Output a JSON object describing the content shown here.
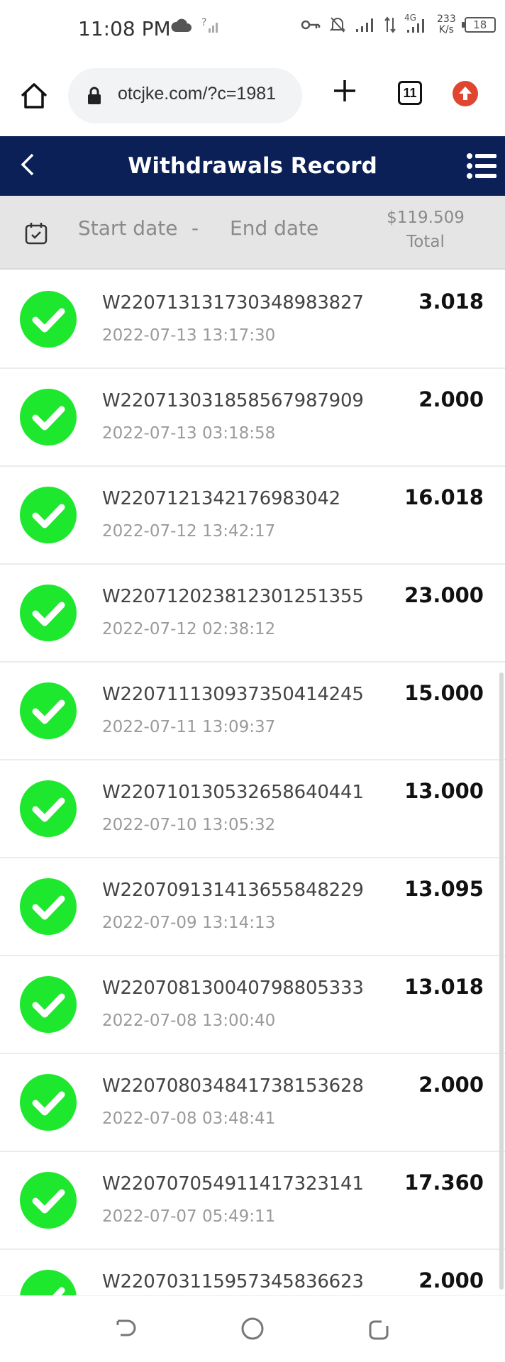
{
  "status_bar": {
    "time": "11:08 PM",
    "speed_value": "233",
    "speed_unit": "K/s",
    "network_label": "4G",
    "battery": "18",
    "icons": [
      "cloud-icon",
      "signal-unknown-icon",
      "vpn-key-icon",
      "bell-off-icon",
      "signal-icon",
      "data-arrows-icon",
      "signal-4g-icon",
      "battery-icon"
    ]
  },
  "browser": {
    "url": "otcjke.com/?c=1981",
    "tab_count": "11"
  },
  "header": {
    "title": "Withdrawals Record"
  },
  "filter": {
    "start_date": "Start date",
    "separator": "-",
    "end_date": "End date",
    "total_amount": "$119.509",
    "total_label": "Total"
  },
  "records": [
    {
      "id": "W220713131730348983827",
      "time": "2022-07-13 13:17:30",
      "amount": "3.018"
    },
    {
      "id": "W220713031858567987909",
      "time": "2022-07-13 03:18:58",
      "amount": "2.000"
    },
    {
      "id": "W2207121342176983042",
      "time": "2022-07-12 13:42:17",
      "amount": "16.018"
    },
    {
      "id": "W220712023812301251355",
      "time": "2022-07-12 02:38:12",
      "amount": "23.000"
    },
    {
      "id": "W220711130937350414245",
      "time": "2022-07-11 13:09:37",
      "amount": "15.000"
    },
    {
      "id": "W220710130532658640441",
      "time": "2022-07-10 13:05:32",
      "amount": "13.000"
    },
    {
      "id": "W220709131413655848229",
      "time": "2022-07-09 13:14:13",
      "amount": "13.095"
    },
    {
      "id": "W220708130040798805333",
      "time": "2022-07-08 13:00:40",
      "amount": "13.018"
    },
    {
      "id": "W220708034841738153628",
      "time": "2022-07-08 03:48:41",
      "amount": "2.000"
    },
    {
      "id": "W220707054911417323141",
      "time": "2022-07-07 05:49:11",
      "amount": "17.360"
    },
    {
      "id": "W220703115957345836623",
      "time": "",
      "amount": "2.000"
    }
  ],
  "colors": {
    "header_bg": "#0b2056",
    "success_green": "#1ee82e",
    "filter_bg": "#e5e5e5",
    "upgrade_red": "#e0452f"
  }
}
